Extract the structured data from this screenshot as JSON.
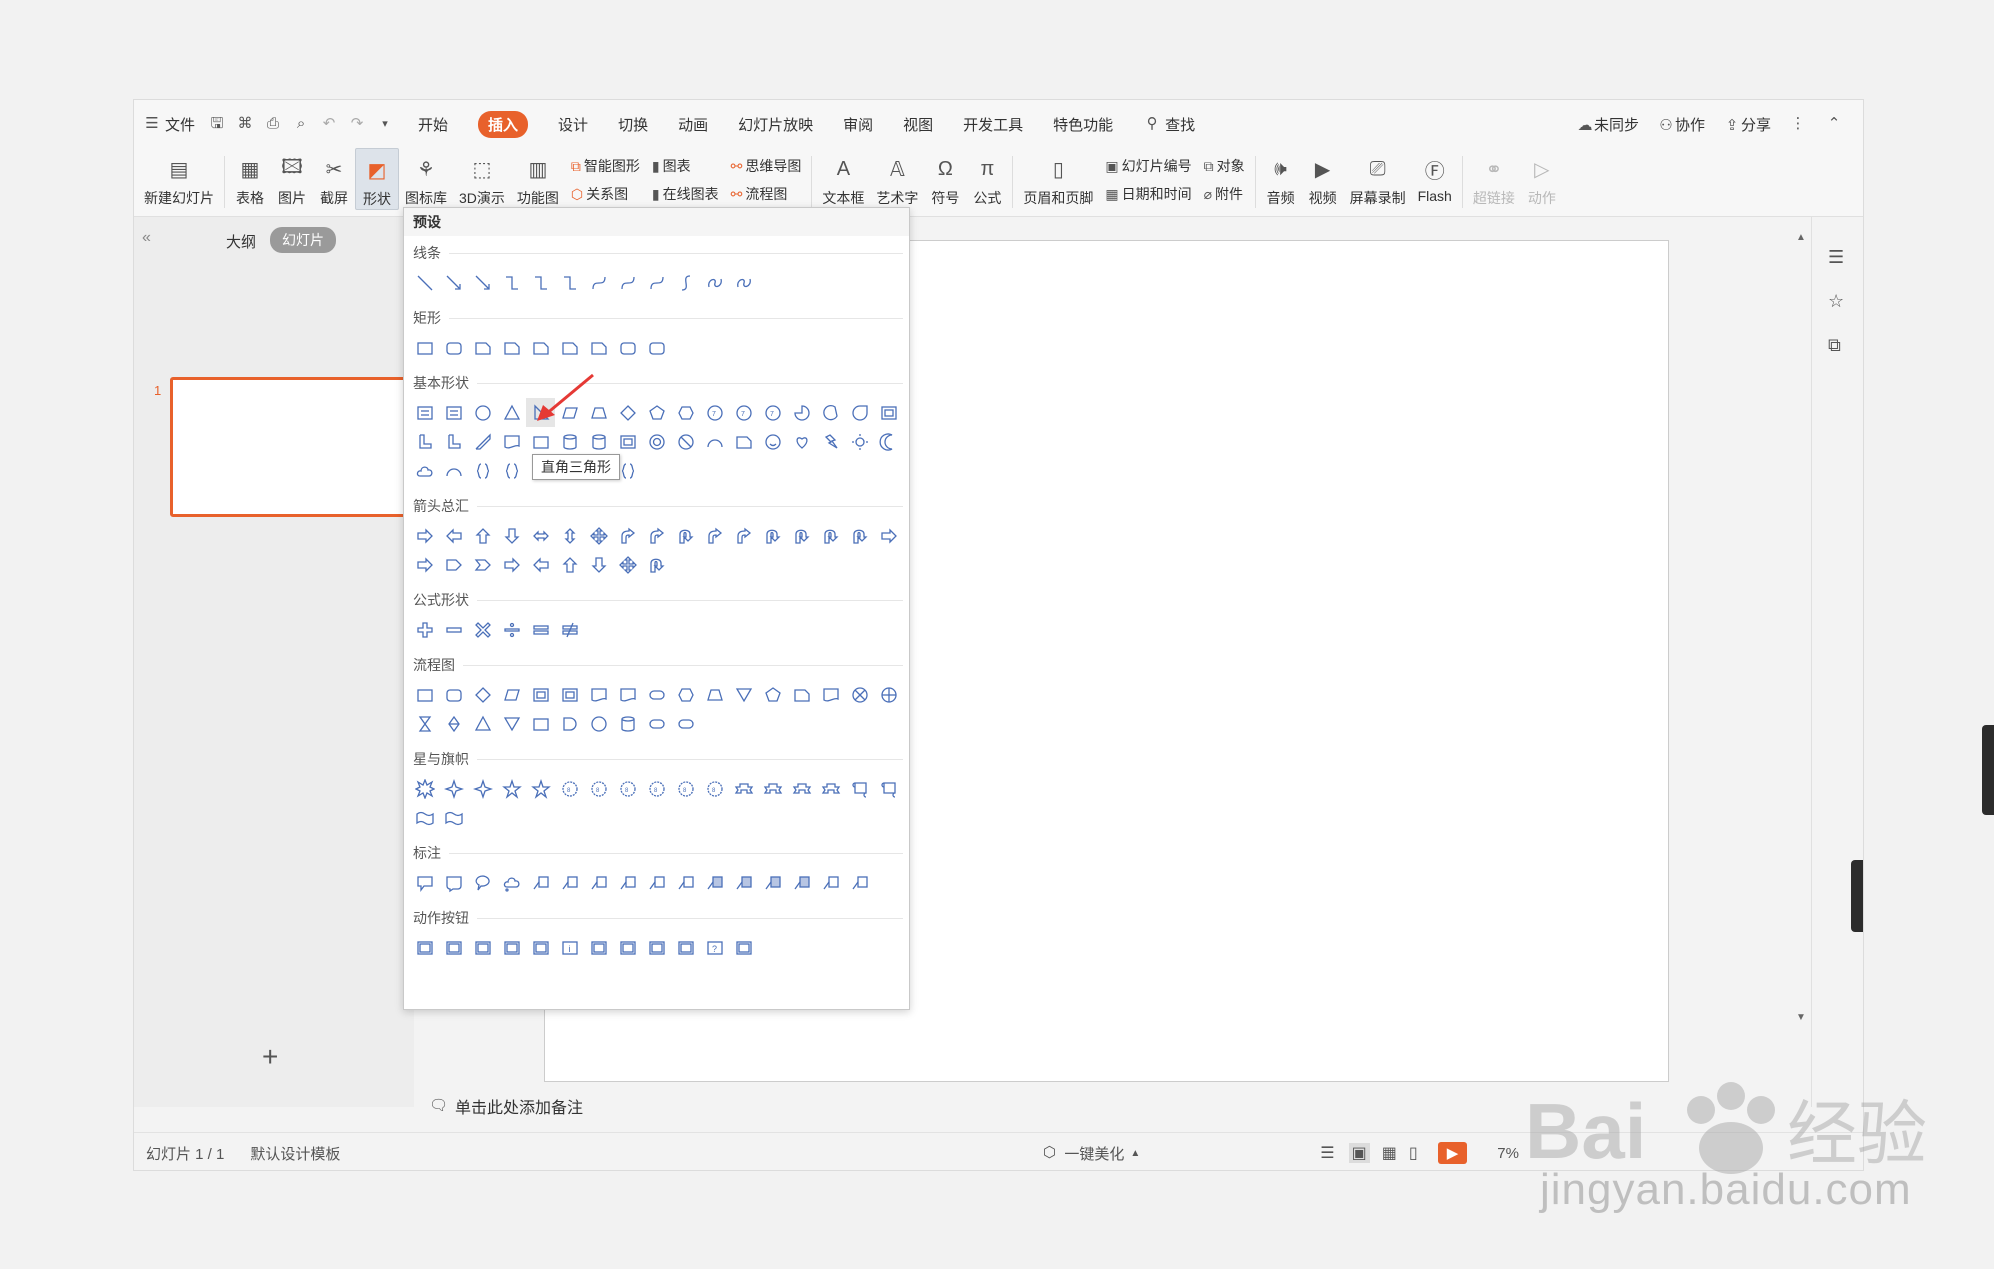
{
  "menubar": {
    "file": "文件",
    "tabs": [
      "开始",
      "插入",
      "设计",
      "切换",
      "动画",
      "幻灯片放映",
      "审阅",
      "视图",
      "开发工具",
      "特色功能"
    ],
    "active_tab": "插入",
    "search": "查找",
    "sync": "未同步",
    "collab": "协作",
    "share": "分享"
  },
  "ribbon": {
    "new_slide": "新建幻灯片",
    "table": "表格",
    "picture": "图片",
    "screenshot": "截屏",
    "shape": "形状",
    "icon_lib": "图标库",
    "demo3d": "3D演示",
    "func_chart": "功能图",
    "smart_art": "智能图形",
    "chart": "图表",
    "relation": "关系图",
    "online_chart": "在线图表",
    "mind_map": "思维导图",
    "flowchart": "流程图",
    "textbox": "文本框",
    "wordart": "艺术字",
    "symbol": "符号",
    "formula": "公式",
    "header_footer": "页眉和页脚",
    "slide_number": "幻灯片编号",
    "object": "对象",
    "datetime": "日期和时间",
    "attachment": "附件",
    "audio": "音频",
    "video": "视频",
    "screen_record": "屏幕录制",
    "flash": "Flash",
    "hyperlink": "超链接",
    "action": "动作"
  },
  "left_pane": {
    "outline": "大纲",
    "slides": "幻灯片",
    "slide_number": "1"
  },
  "notes_placeholder": "单击此处添加备注",
  "status": {
    "slide_count": "幻灯片 1 / 1",
    "template": "默认设计模板",
    "beautify": "一键美化",
    "zoom": "7%"
  },
  "dropdown": {
    "title": "预设",
    "sections": {
      "lines": "线条",
      "rect": "矩形",
      "basic": "基本形状",
      "arrows": "箭头总汇",
      "formula": "公式形状",
      "flow": "流程图",
      "stars": "星与旗帜",
      "callouts": "标注",
      "action_buttons": "动作按钮"
    },
    "tooltip": "直角三角形"
  },
  "watermark": {
    "text": "jingyan.baidu.com",
    "brand": "Bai  经验"
  },
  "colors": {
    "accent": "#e8612b",
    "shape_stroke": "#4a6fb8",
    "arrow": "#e53935"
  }
}
